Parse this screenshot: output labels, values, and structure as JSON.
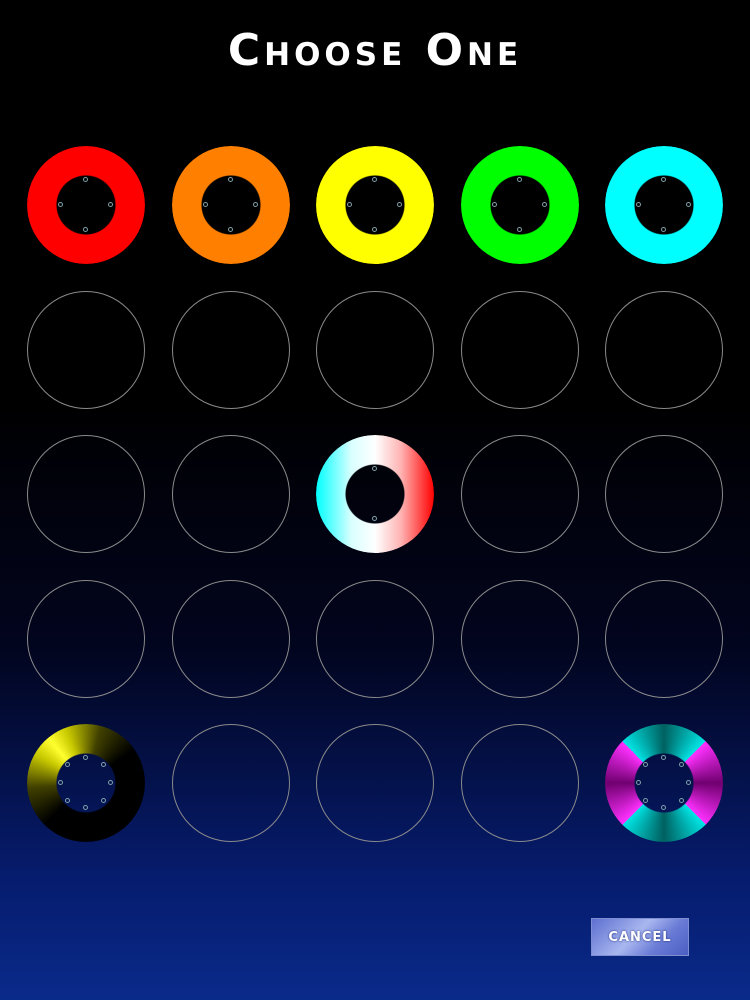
{
  "header": {
    "title": "Choose One"
  },
  "footer": {
    "cancel_label": "CANCEL"
  },
  "colors": {
    "red": "#ff0000",
    "orange": "#ff8000",
    "yellow": "#ffff00",
    "green": "#00ff00",
    "cyan": "#00ffff",
    "empty_outline": "#8a8a8a"
  },
  "grid": {
    "rows": 5,
    "cols": 5,
    "options": [
      {
        "row": 0,
        "col": 0,
        "style": "solid-red"
      },
      {
        "row": 0,
        "col": 1,
        "style": "solid-orange"
      },
      {
        "row": 0,
        "col": 2,
        "style": "solid-yellow"
      },
      {
        "row": 0,
        "col": 3,
        "style": "solid-green"
      },
      {
        "row": 0,
        "col": 4,
        "style": "solid-cyan"
      },
      {
        "row": 2,
        "col": 2,
        "style": "gradient-cyan-white-red"
      },
      {
        "row": 4,
        "col": 0,
        "style": "yellow-black-fade"
      },
      {
        "row": 4,
        "col": 4,
        "style": "cyan-magenta-quadrants"
      }
    ]
  }
}
